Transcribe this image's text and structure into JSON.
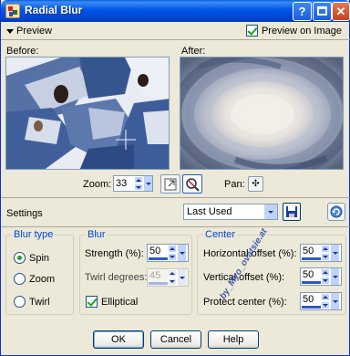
{
  "window": {
    "title": "Radial Blur"
  },
  "preview": {
    "toggle_label": "Preview",
    "preview_on_image_label": "Preview on Image",
    "preview_on_image_checked": true,
    "before_label": "Before:",
    "after_label": "After:"
  },
  "zoom": {
    "label": "Zoom:",
    "value": "33",
    "pan_label": "Pan:"
  },
  "settings": {
    "label": "Settings",
    "preset_value": "Last Used"
  },
  "blur_type": {
    "legend": "Blur type",
    "options": [
      {
        "label": "Spin",
        "selected": true
      },
      {
        "label": "Zoom",
        "selected": false
      },
      {
        "label": "Twirl",
        "selected": false
      }
    ]
  },
  "blur": {
    "legend": "Blur",
    "strength_label": "Strength (%):",
    "strength_value": "50",
    "twirl_label": "Twirl degrees:",
    "twirl_value": "45",
    "elliptical_label": "Elliptical",
    "elliptical_checked": true
  },
  "center": {
    "legend": "Center",
    "h_offset_label": "Horizontal offset (%):",
    "h_offset_value": "50",
    "v_offset_label": "Vertical offset (%):",
    "v_offset_value": "50",
    "protect_label": "Protect center (%):",
    "protect_value": "50"
  },
  "watermark": {
    "text": "by_Myo_ovatsie.at"
  },
  "buttons": {
    "ok": "OK",
    "cancel": "Cancel",
    "help": "Help"
  },
  "colors": {
    "title_bar": "#0055e5",
    "accent_blue": "#0046d5",
    "check_green": "#21a121"
  }
}
